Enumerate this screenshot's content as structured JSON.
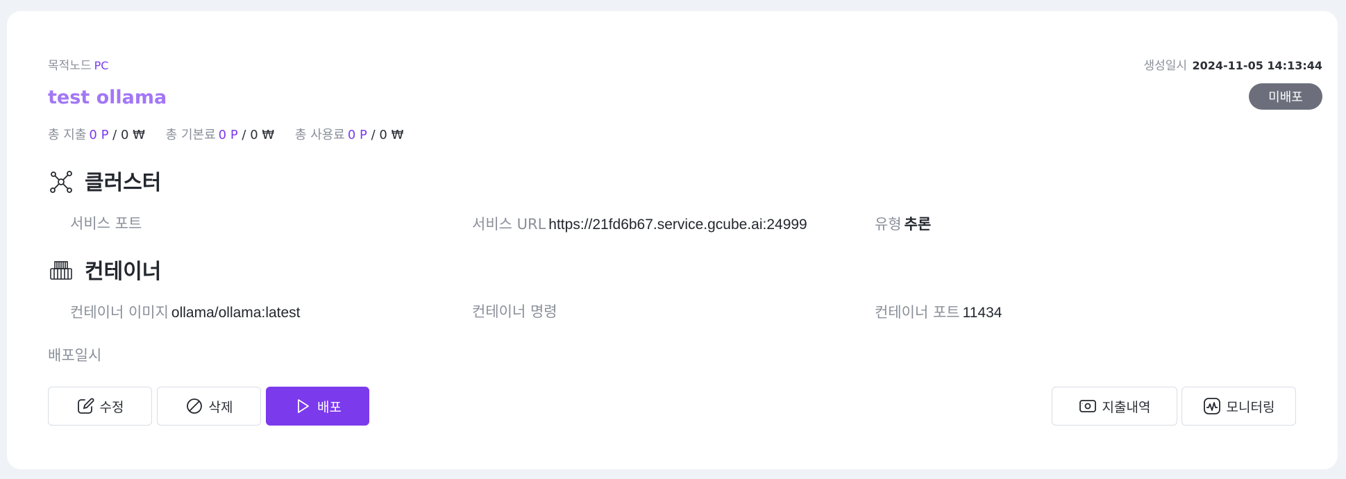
{
  "header": {
    "node_label": "목적노드",
    "node_value": "PC",
    "created_label": "생성일시",
    "created_value": "2024-11-05 14:13:44",
    "title": "test ollama",
    "status": "미배포"
  },
  "costs": [
    {
      "label": "총 지출",
      "points": "0 P",
      "won": "/ 0 ₩"
    },
    {
      "label": "총 기본료",
      "points": "0 P",
      "won": "/ 0 ₩"
    },
    {
      "label": "총 사용료",
      "points": "0 P",
      "won": "/ 0 ₩"
    }
  ],
  "cluster": {
    "title": "클러스터",
    "icon": "network-icon",
    "service_port_label": "서비스 포트",
    "service_url_label": "서비스 URL",
    "service_url_value": "https://21fd6b67.service.gcube.ai:24999",
    "type_label": "유형",
    "type_value": "추론"
  },
  "container": {
    "title": "컨테이너",
    "icon": "container-icon",
    "image_label": "컨테이너 이미지",
    "image_value": "ollama/ollama:latest",
    "command_label": "컨테이너 명령",
    "port_label": "컨테이너 포트",
    "port_value": "11434"
  },
  "deploy_date_label": "배포일시",
  "actions": {
    "edit": "수정",
    "delete": "삭제",
    "deploy": "배포",
    "expenses": "지출내역",
    "monitoring": "모니터링"
  },
  "colors": {
    "accent": "#7c3aed",
    "title": "#a277f5",
    "badge": "#6c6f7b",
    "background": "#eff2f7"
  }
}
